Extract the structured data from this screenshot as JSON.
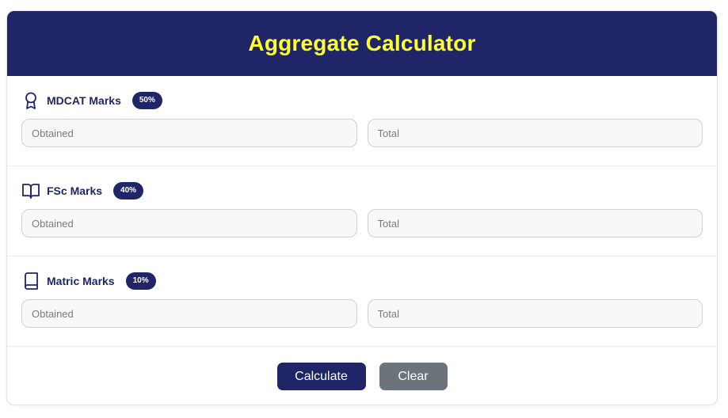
{
  "header": {
    "title": "Aggregate Calculator"
  },
  "sections": [
    {
      "label": "MDCAT Marks",
      "weight": "50%",
      "icon": "award-ribbon-icon",
      "obtained_placeholder": "Obtained",
      "total_placeholder": "Total"
    },
    {
      "label": "FSc Marks",
      "weight": "40%",
      "icon": "open-book-icon",
      "obtained_placeholder": "Obtained",
      "total_placeholder": "Total"
    },
    {
      "label": "Matric Marks",
      "weight": "10%",
      "icon": "closed-book-icon",
      "obtained_placeholder": "Obtained",
      "total_placeholder": "Total"
    }
  ],
  "actions": {
    "calculate_label": "Calculate",
    "clear_label": "Clear"
  },
  "colors": {
    "primary": "#1f2566",
    "title": "#ffff2a",
    "secondary_button": "#6c737b"
  }
}
